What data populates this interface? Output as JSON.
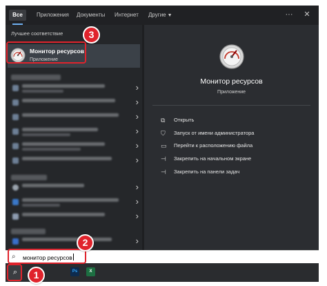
{
  "tabs": {
    "all": "Все",
    "apps": "Приложения",
    "documents": "Документы",
    "web": "Интернет",
    "more": "Другие"
  },
  "top_icons": [
    "more-horizontal-icon",
    "close-icon"
  ],
  "best_match": {
    "section_label": "Лучшее соответствие",
    "title": "Монитор ресурсов",
    "subtitle": "Приложение"
  },
  "preview": {
    "title": "Монитор ресурсов",
    "subtitle": "Приложение",
    "actions": [
      {
        "icon": "open-icon",
        "label": "Открыть"
      },
      {
        "icon": "shield-icon",
        "label": "Запуск от имени администратора"
      },
      {
        "icon": "folder-icon",
        "label": "Перейти к расположению файла"
      },
      {
        "icon": "pin-icon",
        "label": "Закрепить на начальном экране"
      },
      {
        "icon": "pin-icon",
        "label": "Закрепить на панели задач"
      }
    ]
  },
  "search": {
    "value": "монитор ресурсов"
  },
  "taskbar": {
    "apps": [
      {
        "icon": "photoshop-icon",
        "label": "Ps",
        "color": "#0d2b4e",
        "text_color": "#31a8ff"
      },
      {
        "icon": "excel-icon",
        "label": "X",
        "color": "#1d6f42",
        "text_color": "#ffffff"
      }
    ]
  },
  "annotations": {
    "step1": "1",
    "step2": "2",
    "step3": "3",
    "color": "#e0232c"
  },
  "colors": {
    "panel_bg": "#1e1f21",
    "left_bg": "#25272a",
    "right_bg": "#2b2d31",
    "selected_bg": "#3b4148",
    "accent": "#6fb0f2"
  }
}
